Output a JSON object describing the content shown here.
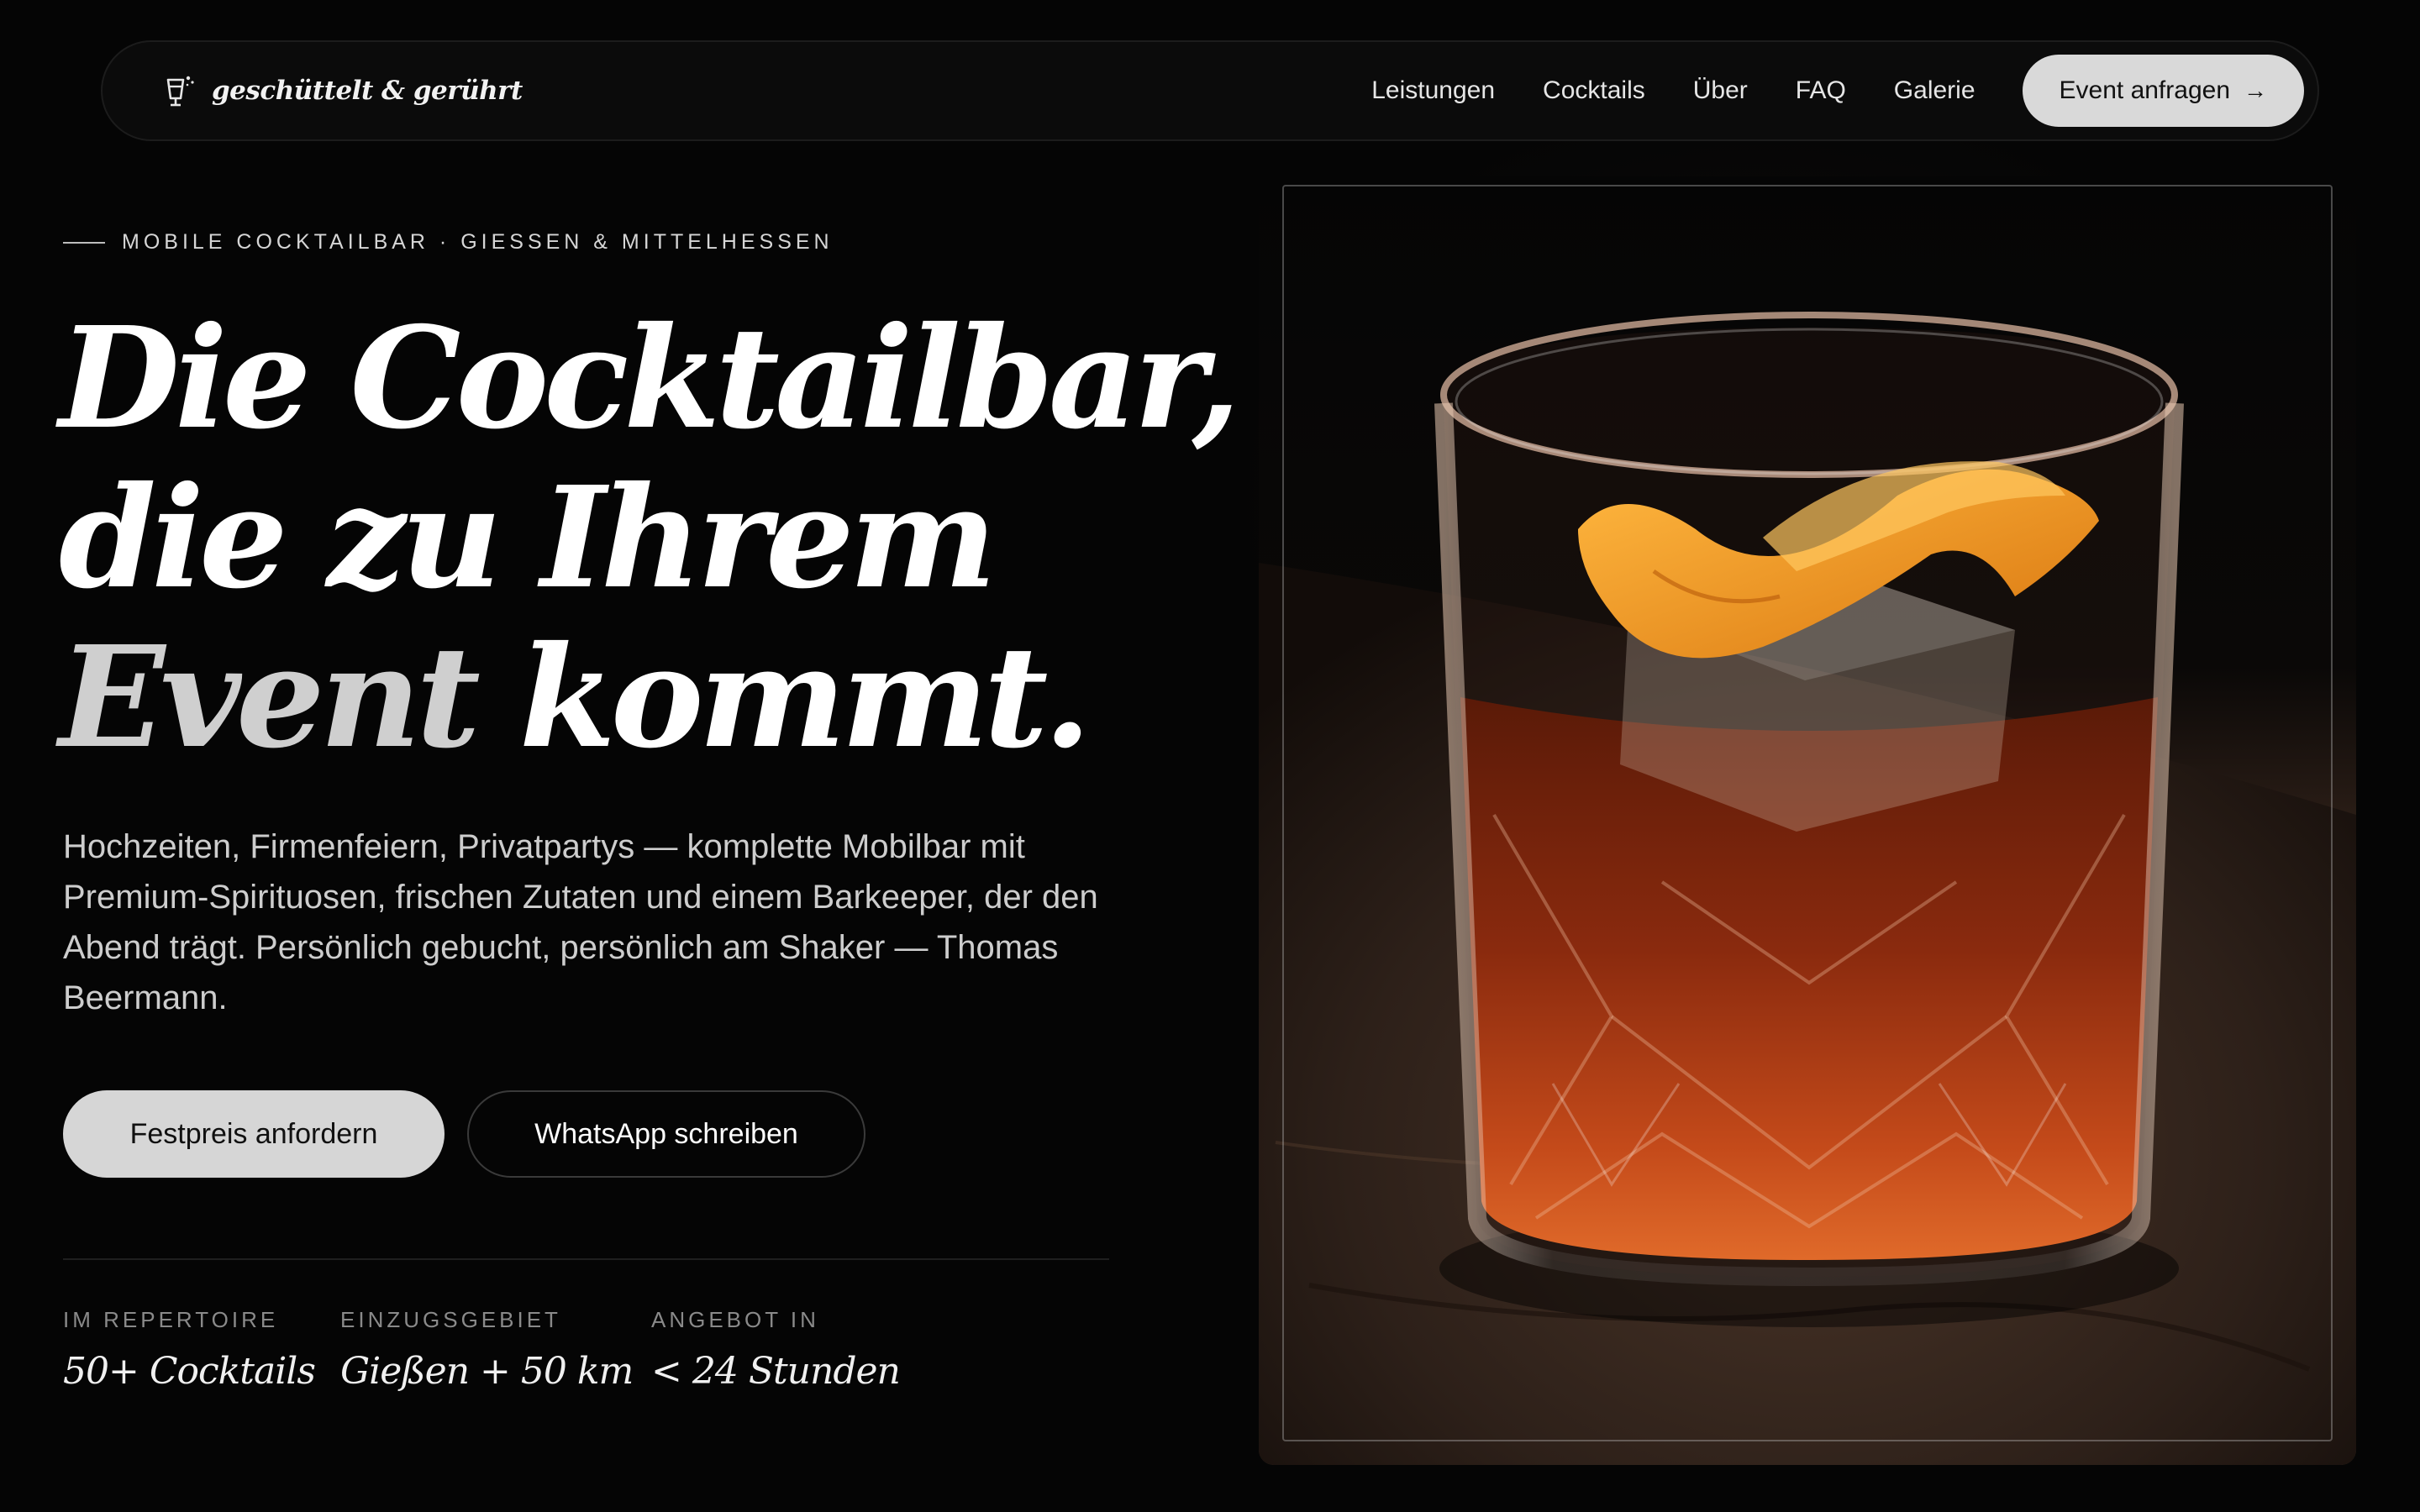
{
  "nav": {
    "brand": "geschüttelt & gerührt",
    "brand_icon": "cocktail-glass-icon",
    "links": [
      "Leistungen",
      "Cocktails",
      "Über",
      "FAQ",
      "Galerie"
    ],
    "cta_label": "Event anfragen",
    "cta_icon": "arrow-right-icon"
  },
  "hero": {
    "eyebrow": "MOBILE COCKTAILBAR · GIESSEN & MITTELHESSEN",
    "headline": {
      "line1": "Die Cocktailbar,",
      "line2": "die zu Ihrem",
      "line3_muted": "Event",
      "line3_strong": "kommt."
    },
    "lead": "Hochzeiten, Firmenfeiern, Privatpartys — komplette Mobilbar mit Premium-Spirituosen, frischen Zutaten und einem Barkeeper, der den Abend trägt. Persönlich gebucht, persönlich am Shaker — Thomas Beermann.",
    "primary_button": "Festpreis anfordern",
    "secondary_button": "WhatsApp schreiben",
    "stats": [
      {
        "label": "IM REPERTOIRE",
        "value": "50+ Cocktails"
      },
      {
        "label": "EINZUGSGEBIET",
        "value": "Gießen + 50 km"
      },
      {
        "label": "ANGEBOT IN",
        "value": "< 24 Stunden"
      }
    ]
  },
  "colors": {
    "background": "#050505",
    "cta_background": "#d9d9d9",
    "drink": "#8a2a0e",
    "orange_peel": "#f0a030"
  }
}
